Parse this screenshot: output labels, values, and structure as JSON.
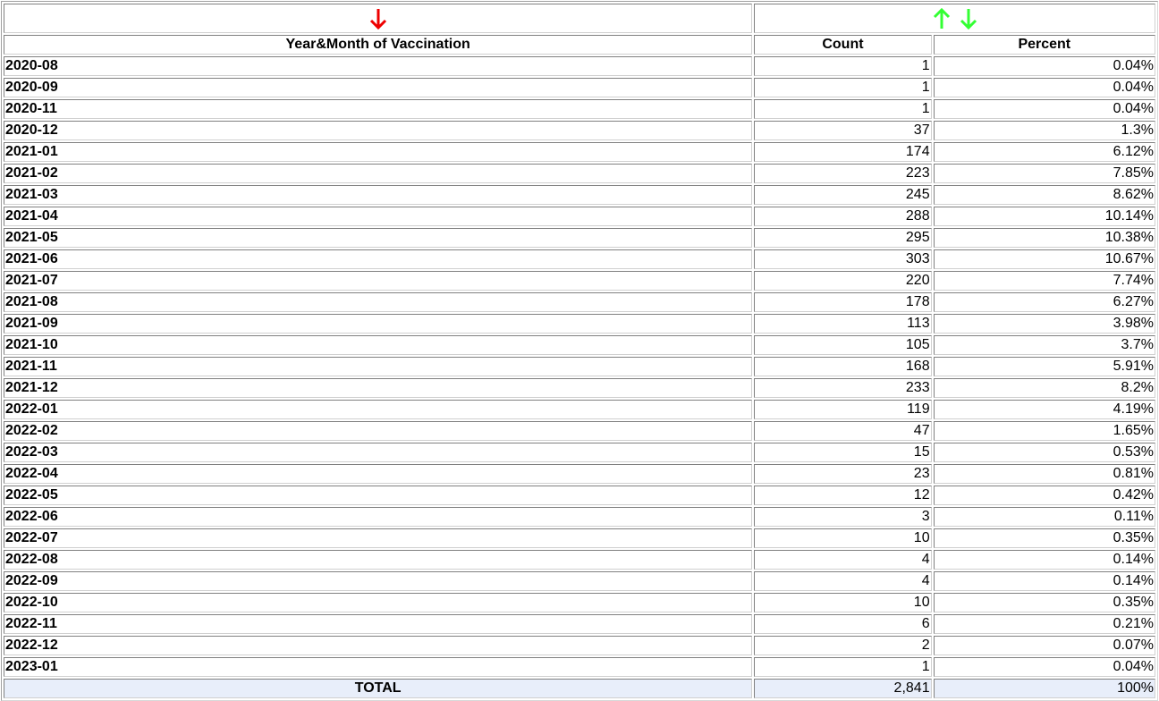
{
  "table": {
    "sort_icons": {
      "label_column": {
        "icon": "arrow-down-icon",
        "color": "#ee0000"
      },
      "value_columns": [
        {
          "icon": "arrow-up-icon",
          "color": "#33ff33"
        },
        {
          "icon": "arrow-down-icon",
          "color": "#33ff33"
        }
      ]
    },
    "headers": {
      "label": "Year&Month of Vaccination",
      "count": "Count",
      "percent": "Percent"
    },
    "rows": [
      {
        "label": "2020-08",
        "count": "1",
        "percent": "0.04%"
      },
      {
        "label": "2020-09",
        "count": "1",
        "percent": "0.04%"
      },
      {
        "label": "2020-11",
        "count": "1",
        "percent": "0.04%"
      },
      {
        "label": "2020-12",
        "count": "37",
        "percent": "1.3%"
      },
      {
        "label": "2021-01",
        "count": "174",
        "percent": "6.12%"
      },
      {
        "label": "2021-02",
        "count": "223",
        "percent": "7.85%"
      },
      {
        "label": "2021-03",
        "count": "245",
        "percent": "8.62%"
      },
      {
        "label": "2021-04",
        "count": "288",
        "percent": "10.14%"
      },
      {
        "label": "2021-05",
        "count": "295",
        "percent": "10.38%"
      },
      {
        "label": "2021-06",
        "count": "303",
        "percent": "10.67%"
      },
      {
        "label": "2021-07",
        "count": "220",
        "percent": "7.74%"
      },
      {
        "label": "2021-08",
        "count": "178",
        "percent": "6.27%"
      },
      {
        "label": "2021-09",
        "count": "113",
        "percent": "3.98%"
      },
      {
        "label": "2021-10",
        "count": "105",
        "percent": "3.7%"
      },
      {
        "label": "2021-11",
        "count": "168",
        "percent": "5.91%"
      },
      {
        "label": "2021-12",
        "count": "233",
        "percent": "8.2%"
      },
      {
        "label": "2022-01",
        "count": "119",
        "percent": "4.19%"
      },
      {
        "label": "2022-02",
        "count": "47",
        "percent": "1.65%"
      },
      {
        "label": "2022-03",
        "count": "15",
        "percent": "0.53%"
      },
      {
        "label": "2022-04",
        "count": "23",
        "percent": "0.81%"
      },
      {
        "label": "2022-05",
        "count": "12",
        "percent": "0.42%"
      },
      {
        "label": "2022-06",
        "count": "3",
        "percent": "0.11%"
      },
      {
        "label": "2022-07",
        "count": "10",
        "percent": "0.35%"
      },
      {
        "label": "2022-08",
        "count": "4",
        "percent": "0.14%"
      },
      {
        "label": "2022-09",
        "count": "4",
        "percent": "0.14%"
      },
      {
        "label": "2022-10",
        "count": "10",
        "percent": "0.35%"
      },
      {
        "label": "2022-11",
        "count": "6",
        "percent": "0.21%"
      },
      {
        "label": "2022-12",
        "count": "2",
        "percent": "0.07%"
      },
      {
        "label": "2023-01",
        "count": "1",
        "percent": "0.04%"
      }
    ],
    "total": {
      "label": "TOTAL",
      "count": "2,841",
      "percent": "100%"
    },
    "total_row_background": "#e8eefa"
  }
}
